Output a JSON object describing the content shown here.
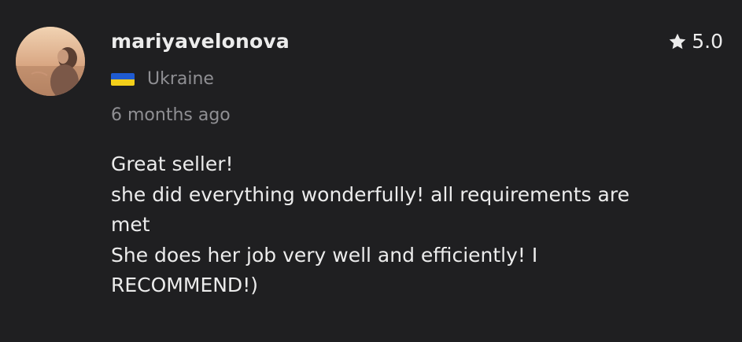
{
  "review": {
    "username": "mariyavelonova",
    "rating": "5.0",
    "country": "Ukraine",
    "country_flag": "ukraine-flag-icon",
    "timestamp": "6 months ago",
    "body_lines": [
      "Great seller!",
      "she did everything wonderfully! all requirements are",
      "met",
      "She does her job very well and efficiently! I",
      "RECOMMEND!)"
    ]
  },
  "colors": {
    "background": "#1f1f21",
    "primary_text": "#ececec",
    "secondary_text": "#8f8f93",
    "flag_blue": "#1f5bd1",
    "flag_yellow": "#f3cf1a"
  }
}
